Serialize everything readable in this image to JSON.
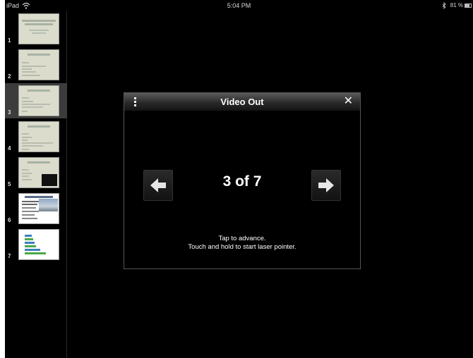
{
  "status_bar": {
    "device": "iPad",
    "time": "5:04 PM",
    "battery": "81 %"
  },
  "sidebar": {
    "slides": [
      {
        "number": "1"
      },
      {
        "number": "2"
      },
      {
        "number": "3",
        "selected": true
      },
      {
        "number": "4"
      },
      {
        "number": "5"
      },
      {
        "number": "6"
      },
      {
        "number": "7"
      }
    ]
  },
  "dialog": {
    "title": "Video Out",
    "counter": "3 of 7",
    "hint_line1": "Tap to advance.",
    "hint_line2": "Touch and hold to start laser pointer."
  },
  "icons": {
    "menu": "menu-icon",
    "close": "close-icon",
    "prev": "left-arrow-icon",
    "next": "right-arrow-icon",
    "wifi": "wifi-icon",
    "bluetooth": "bluetooth-icon",
    "battery": "battery-icon"
  },
  "colors": {
    "background": "#000000",
    "selected_row": "#3c3c3c",
    "thumb_beige": "#dcdccc"
  }
}
